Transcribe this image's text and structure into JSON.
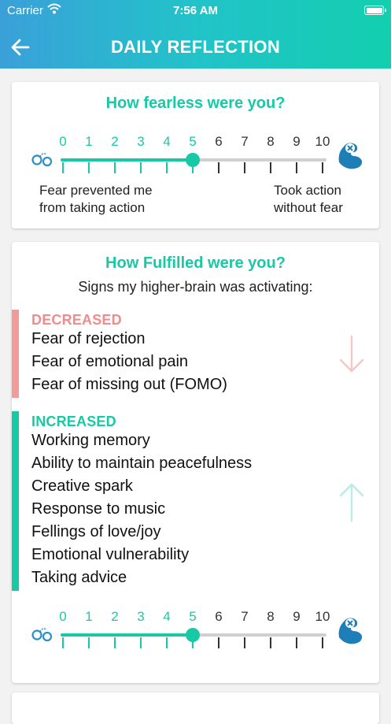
{
  "status_bar": {
    "carrier": "Carrier",
    "time": "7:56 AM"
  },
  "header": {
    "title": "DAILY REFLECTION"
  },
  "fearless_card": {
    "title": "How fearless were you?",
    "scale_labels": [
      "0",
      "1",
      "2",
      "3",
      "4",
      "5",
      "6",
      "7",
      "8",
      "9",
      "10"
    ],
    "value": 5,
    "low_caption_line1": "Fear prevented me",
    "low_caption_line2": "from taking action",
    "high_caption_line1": "Took action",
    "high_caption_line2": "without fear"
  },
  "fulfilled_card": {
    "title": "How Fulfilled were you?",
    "subtitle": "Signs my higher-brain was activating:",
    "decreased": {
      "label": "DECREASED",
      "items": [
        "Fear of rejection",
        "Fear of emotional pain",
        "Fear of missing out (FOMO)"
      ]
    },
    "increased": {
      "label": "INCREASED",
      "items": [
        "Working memory",
        "Ability to maintain peacefulness",
        "Creative spark",
        "Response to music",
        "Fellings of love/joy",
        "Emotional vulnerability",
        "Taking advice"
      ]
    },
    "scale_labels": [
      "0",
      "1",
      "2",
      "3",
      "4",
      "5",
      "6",
      "7",
      "8",
      "9",
      "10"
    ],
    "value": 5
  },
  "colors": {
    "accent": "#18c9a6",
    "decreased": "#f39a9a",
    "increased": "#18c9a6",
    "header_start": "#3aa0d9",
    "header_end": "#12cfae"
  },
  "icons": {
    "back": "arrow-left-icon",
    "low_end": "handcuffs-icon",
    "high_end": "flexed-arm-icon",
    "decreased_arrow": "arrow-down-icon",
    "increased_arrow": "arrow-up-icon"
  }
}
